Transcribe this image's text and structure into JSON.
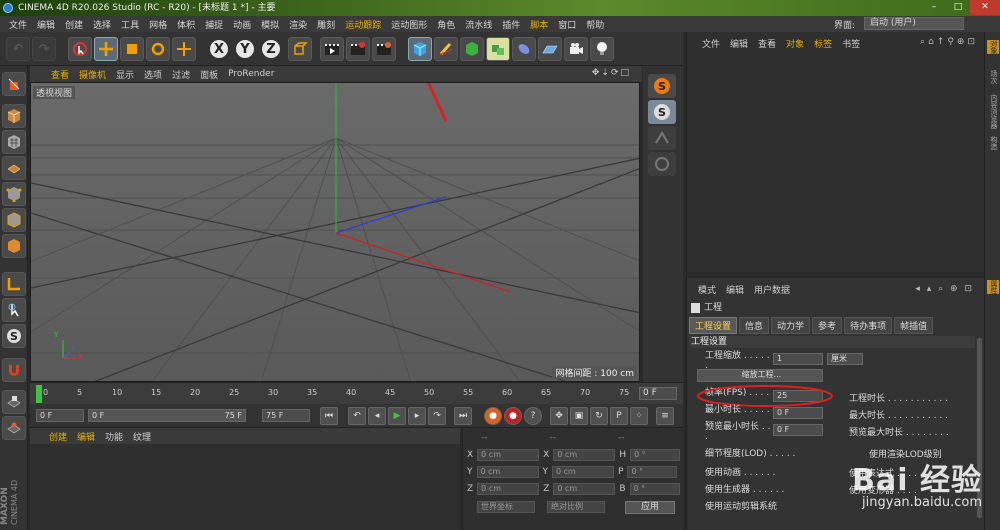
{
  "window": {
    "title": "CINEMA 4D R20.026 Studio (RC - R20) - [未标题 1 *] - 主要"
  },
  "menubar": {
    "items": [
      "文件",
      "编辑",
      "创建",
      "选择",
      "工具",
      "网格",
      "体积",
      "捕捉",
      "动画",
      "模拟",
      "渲染",
      "雕刻",
      "运动跟踪",
      "运动图形",
      "角色",
      "流水线",
      "插件",
      "脚本",
      "窗口",
      "帮助"
    ],
    "highlight": [
      "运动跟踪",
      "脚本"
    ],
    "layout_label": "界面:",
    "layout_value": "启动 (用户)"
  },
  "toolbar": {
    "x": "X",
    "y": "Y",
    "z": "Z"
  },
  "viewport": {
    "menu": [
      "查看",
      "摄像机",
      "显示",
      "选项",
      "过滤",
      "面板",
      "ProRender"
    ],
    "highlight": [
      "查看",
      "摄像机"
    ],
    "label": "透视视图",
    "grid_spacing": "网格间距 : 100 cm",
    "axes": {
      "y": "Y",
      "x": "X",
      "z": "Z"
    }
  },
  "timeline": {
    "ticks": [
      "0",
      "5",
      "10",
      "15",
      "20",
      "25",
      "30",
      "35",
      "40",
      "45",
      "50",
      "55",
      "60",
      "65",
      "70",
      "75"
    ],
    "end_frame": "0 F"
  },
  "playbar": {
    "start": "0 F",
    "range_start": "0 F",
    "range_end": "75 F",
    "end": "75 F"
  },
  "material_panel": {
    "menu": [
      "创建",
      "编辑",
      "功能",
      "纹理"
    ]
  },
  "coordinates": {
    "header": [
      "--",
      "--",
      "--"
    ],
    "rows": [
      {
        "a": "X",
        "av": "0 cm",
        "b": "X",
        "bv": "0 cm",
        "c": "H",
        "cv": "0 °"
      },
      {
        "a": "Y",
        "av": "0 cm",
        "b": "Y",
        "bv": "0 cm",
        "c": "P",
        "cv": "0 °"
      },
      {
        "a": "Z",
        "av": "0 cm",
        "b": "Z",
        "bv": "0 cm",
        "c": "B",
        "cv": "0 °"
      }
    ],
    "mode1": "世界坐标",
    "mode2": "绝对比例",
    "apply": "应用"
  },
  "maxon": {
    "line1": "MAXON",
    "line2": "CINEMA 4D"
  },
  "object_panel": {
    "menu": [
      "文件",
      "编辑",
      "查看",
      "对象",
      "标签",
      "书签"
    ],
    "highlight": [
      "对象",
      "标签"
    ]
  },
  "right_tabs": [
    "对象",
    "场次",
    "内容浏览器",
    "构造"
  ],
  "attr_right_tab": "属性",
  "attributes": {
    "menu": [
      "模式",
      "编辑",
      "用户数据"
    ],
    "header": "工程",
    "tabs": [
      "工程设置",
      "信息",
      "动力学",
      "参考",
      "待办事项",
      "帧插值"
    ],
    "section": "工程设置",
    "rows": {
      "scale_label": "工程缩放 . . . . . .",
      "scale_value": "1",
      "scale_unit": "厘米",
      "scale_button": "缩放工程...",
      "fps_label": "帧率(FPS) . . . . . .",
      "fps_value": "25",
      "project_time_label": "工程时长 . . . . . . . . . . .",
      "min_time_label": "最小时长 . . . . . .",
      "min_time_value": "0 F",
      "max_time_label": "最大时长 . . . . . . . . . . .",
      "preview_min_label": "预览最小时长 . . .",
      "preview_min_value": "0 F",
      "preview_max_label": "预览最大时长 . . . . . . . .",
      "lod_label": "细节程度(LOD) . . . . .",
      "lod_render_label": "使用渲染LOD级别",
      "use_anim_label": "使用动画 . . . . . .",
      "use_expr_label": "使用表达式 . . . .",
      "use_gen_label": "使用生成器 . . . . . .",
      "use_deform_label": "使用变形器 . . . .",
      "use_motion_label": "使用运动剪辑系统"
    }
  },
  "watermark": {
    "brand": "Bai 经验",
    "url": "jingyan.baidu.com"
  },
  "colors": {
    "accent": "#e8b100",
    "highlight_ellipse": "#e02020",
    "arrow": "#e02020"
  }
}
